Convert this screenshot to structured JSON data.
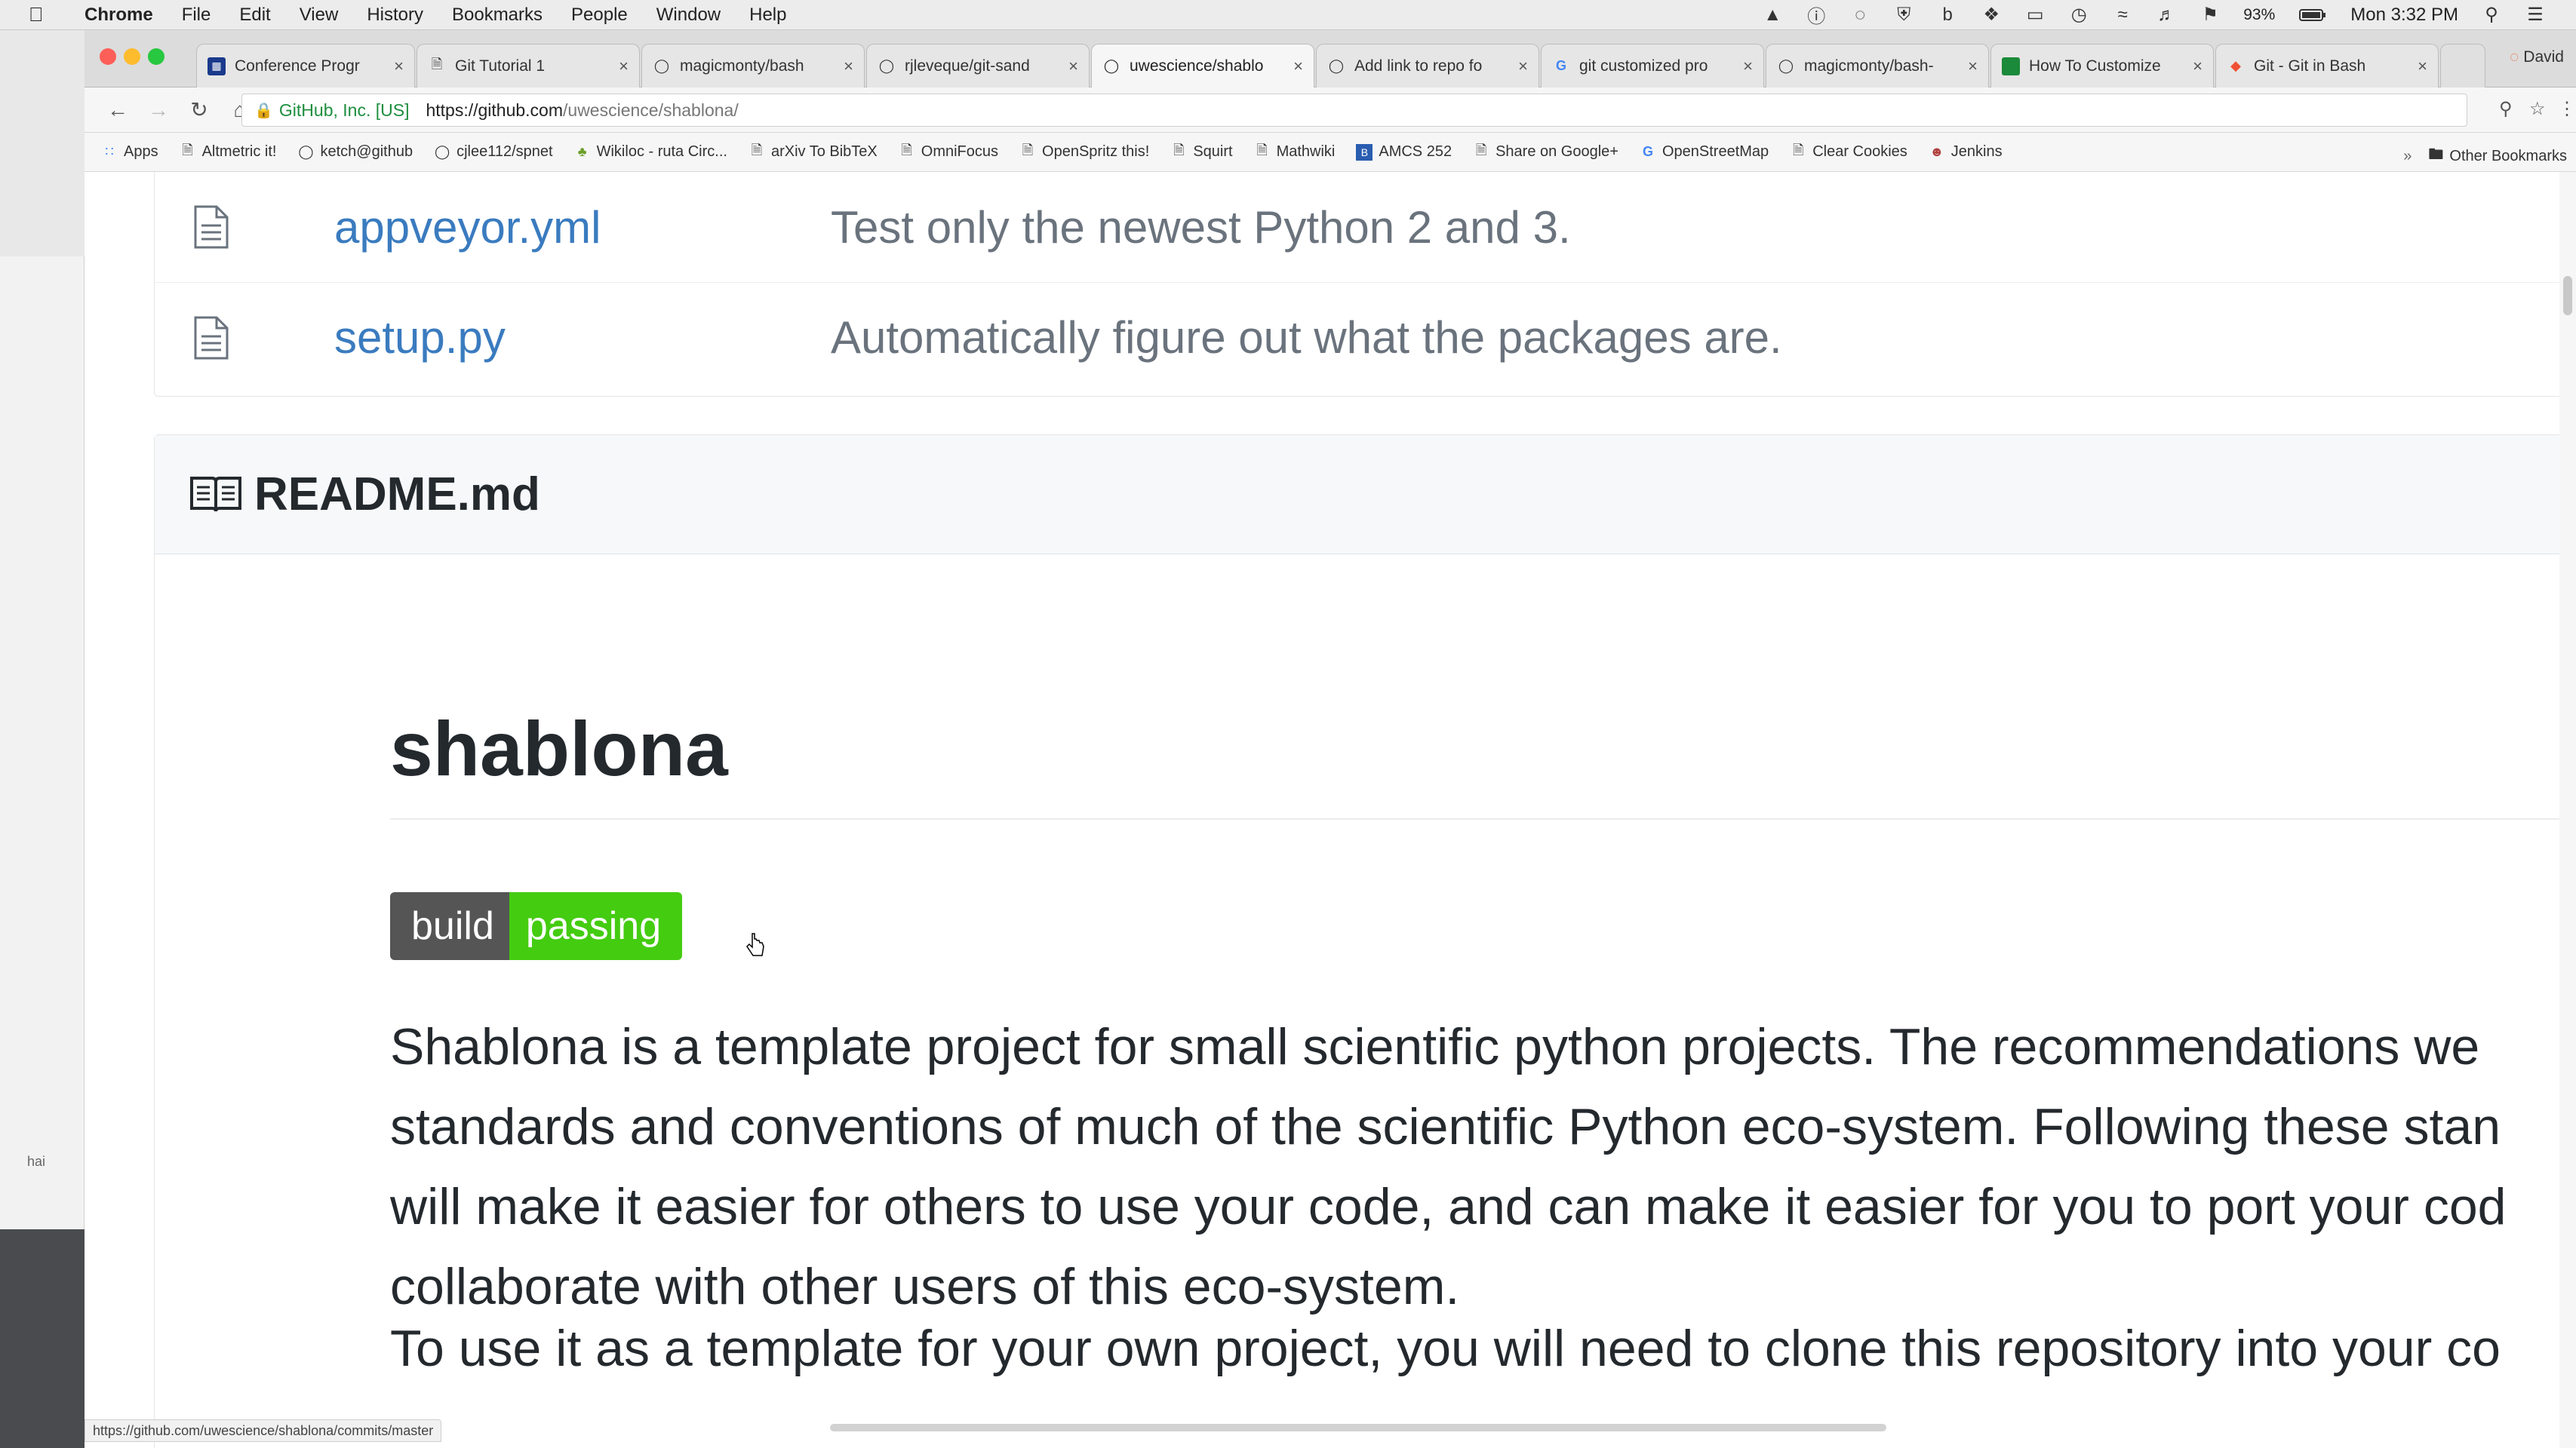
{
  "menubar": {
    "app": "Chrome",
    "items": [
      "File",
      "Edit",
      "View",
      "History",
      "Bookmarks",
      "People",
      "Window",
      "Help"
    ],
    "battery": "93%",
    "clock": "Mon 3:32 PM"
  },
  "left_window": {
    "hint": "hai"
  },
  "tabs": [
    {
      "label": "Conference Progr",
      "icon": "calendar-icon"
    },
    {
      "label": "Git Tutorial 1",
      "icon": "page-icon"
    },
    {
      "label": "magicmonty/bash",
      "icon": "github-icon"
    },
    {
      "label": "rjleveque/git-sand",
      "icon": "github-icon"
    },
    {
      "label": "uwescience/shablo",
      "icon": "github-icon",
      "active": true
    },
    {
      "label": "Add link to repo fo",
      "icon": "github-icon"
    },
    {
      "label": "git customized pro",
      "icon": "google-icon"
    },
    {
      "label": "magicmonty/bash-",
      "icon": "github-icon"
    },
    {
      "label": "How To Customize",
      "icon": "green-square-icon"
    },
    {
      "label": "Git - Git in Bash",
      "icon": "git-icon"
    }
  ],
  "profile": "David",
  "address": {
    "org": "GitHub, Inc. [US]",
    "host": "https://github.com",
    "path": "/uwescience/shablona/"
  },
  "bookmarks": [
    {
      "label": "Apps",
      "icon": "apps-grid-icon"
    },
    {
      "label": "Altmetric it!",
      "icon": "page-icon"
    },
    {
      "label": "ketch@github",
      "icon": "github-icon"
    },
    {
      "label": "cjlee112/spnet",
      "icon": "github-icon"
    },
    {
      "label": "Wikiloc - ruta Circ...",
      "icon": "wikiloc-icon"
    },
    {
      "label": "arXiv To BibTeX",
      "icon": "page-icon"
    },
    {
      "label": "OmniFocus",
      "icon": "page-icon"
    },
    {
      "label": "OpenSpritz this!",
      "icon": "page-icon"
    },
    {
      "label": "Squirt",
      "icon": "page-icon"
    },
    {
      "label": "Mathwiki",
      "icon": "page-icon"
    },
    {
      "label": "AMCS 252",
      "icon": "blue-square-icon"
    },
    {
      "label": "Share on Google+",
      "icon": "page-icon"
    },
    {
      "label": "OpenStreetMap",
      "icon": "google-icon"
    },
    {
      "label": "Clear Cookies",
      "icon": "page-icon"
    },
    {
      "label": "Jenkins",
      "icon": "jenkins-icon"
    }
  ],
  "other_bookmarks": "Other Bookmarks",
  "files": [
    {
      "name": "appveyor.yml",
      "message": "Test only the newest Python 2 and 3."
    },
    {
      "name": "setup.py",
      "message": "Automatically figure out what the packages are."
    }
  ],
  "readme": {
    "header": "README.md",
    "title": "shablona",
    "badge_left": "build",
    "badge_right": "passing",
    "para1_lines": [
      "Shablona is a template project for small scientific python projects. The recommendations we",
      "standards and conventions of much of the scientific Python eco-system. Following these stan",
      "will make it easier for others to use your code, and can make it easier for you to port your cod",
      "collaborate with other users of this eco-system."
    ],
    "para2_line": "To use it as a template for your own project, you will need to clone this repository into your co"
  },
  "status_url": "https://github.com/uwescience/shablona/commits/master",
  "colors": {
    "link": "#3a7bbf",
    "badge_pass": "#44cc11",
    "badge_label": "#555555"
  }
}
